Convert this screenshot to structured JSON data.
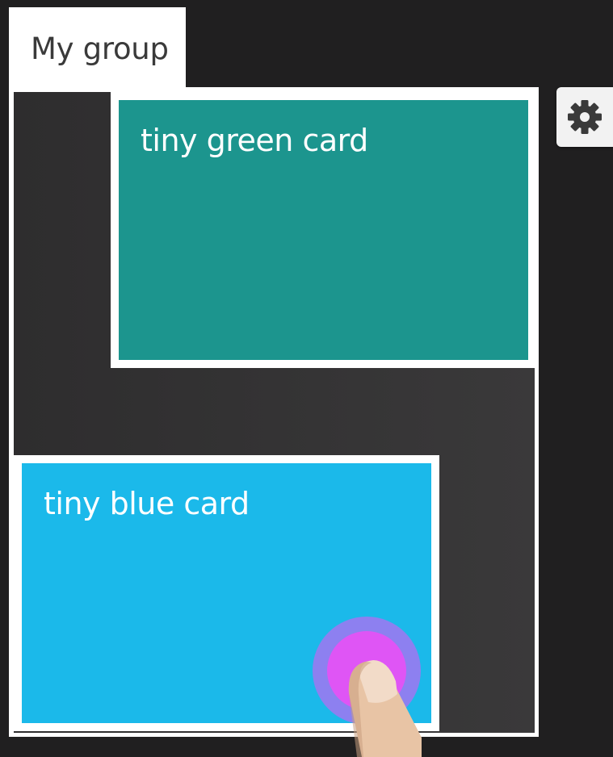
{
  "group": {
    "title": "My group"
  },
  "cards": [
    {
      "title": "tiny green card",
      "color": "#1c958e"
    },
    {
      "title": "tiny blue card",
      "color": "#1bb9ea"
    }
  ],
  "settings": {
    "icon": "gear-icon"
  },
  "touch": {
    "icon": "finger-tap-icon",
    "ring_outer": "#8d80f0",
    "ring_inner": "#df55f5"
  }
}
